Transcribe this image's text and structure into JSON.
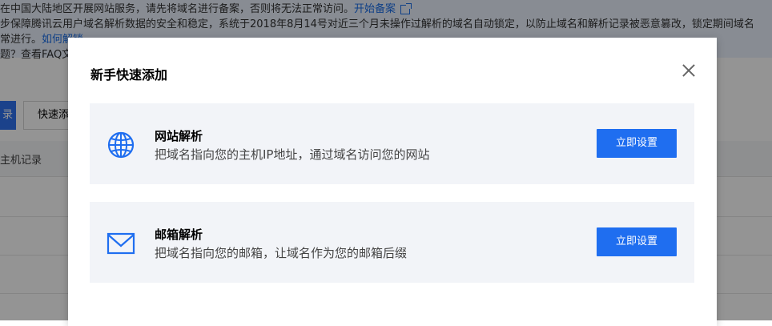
{
  "background": {
    "notice": {
      "line1": "在中国大陆地区开展网站服务，请先将域名进行备案，否则将无法正常访问。",
      "line1_link": "开始备案",
      "line2": "步保障腾讯云用户域名解析数据的安全和稳定，系统于2018年8月14号对近三个月未操作过解析的域名自动锁定，以防止域名和解析记录被恶意篡改，锁定期间域名",
      "line3": "常进行。",
      "line3_link": "如何解锁",
      "line4": "题？查看FAQ文"
    },
    "toolbar": {
      "primary_label": "录",
      "quick_add_label": "快速添"
    },
    "table": {
      "first_header": "主机记录"
    }
  },
  "modal": {
    "title": "新手快速添加",
    "cards": [
      {
        "icon": "globe-icon",
        "title": "网站解析",
        "description": "把域名指向您的主机IP地址，通过域名访问您的网站",
        "button": "立即设置"
      },
      {
        "icon": "mail-icon",
        "title": "邮箱解析",
        "description": "把域名指向您的邮箱，让域名作为您的邮箱后缀",
        "button": "立即设置"
      }
    ]
  },
  "colors": {
    "primary": "#1f6ef0",
    "card_bg": "#f2f4f8",
    "notice_bg": "#eaf1fd"
  }
}
